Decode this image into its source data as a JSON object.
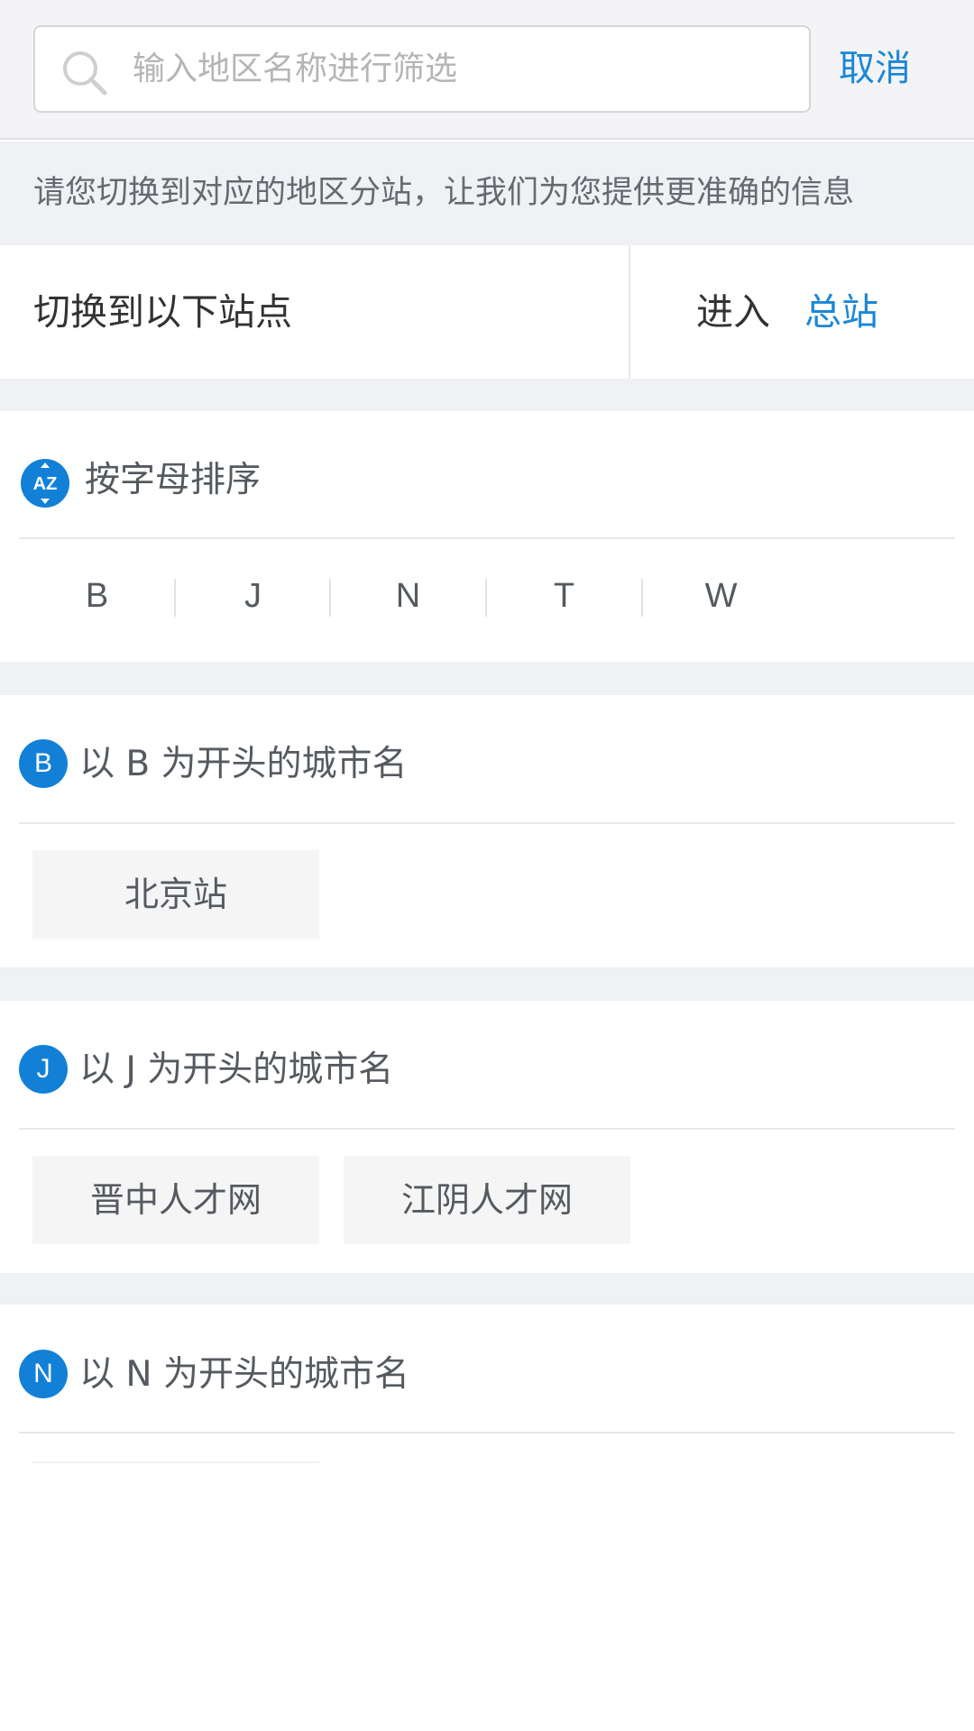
{
  "search": {
    "placeholder": "输入地区名称进行筛选",
    "value": "",
    "cancel_label": "取消"
  },
  "hint": {
    "text": "请您切换到对应的地区分站，让我们为您提供更准确的信息"
  },
  "switch": {
    "label": "切换到以下站点",
    "enter_prefix": "进入",
    "enter_link": "总站"
  },
  "alpha_sort": {
    "title": "按字母排序",
    "icon": "az-sort-icon",
    "letters": [
      "B",
      "J",
      "N",
      "T",
      "W"
    ]
  },
  "groups": [
    {
      "badge": "B",
      "title": "以 B 为开头的城市名",
      "cities": [
        "北京站"
      ]
    },
    {
      "badge": "J",
      "title": "以 J 为开头的城市名",
      "cities": [
        "晋中人才网",
        "江阴人才网"
      ]
    },
    {
      "badge": "N",
      "title": "以 N 为开头的城市名",
      "cities": []
    }
  ],
  "colors": {
    "accent": "#1a87d9",
    "badge": "#1380d7",
    "gap_background": "#f0f1f4",
    "chip_background": "#f5f5f6"
  }
}
